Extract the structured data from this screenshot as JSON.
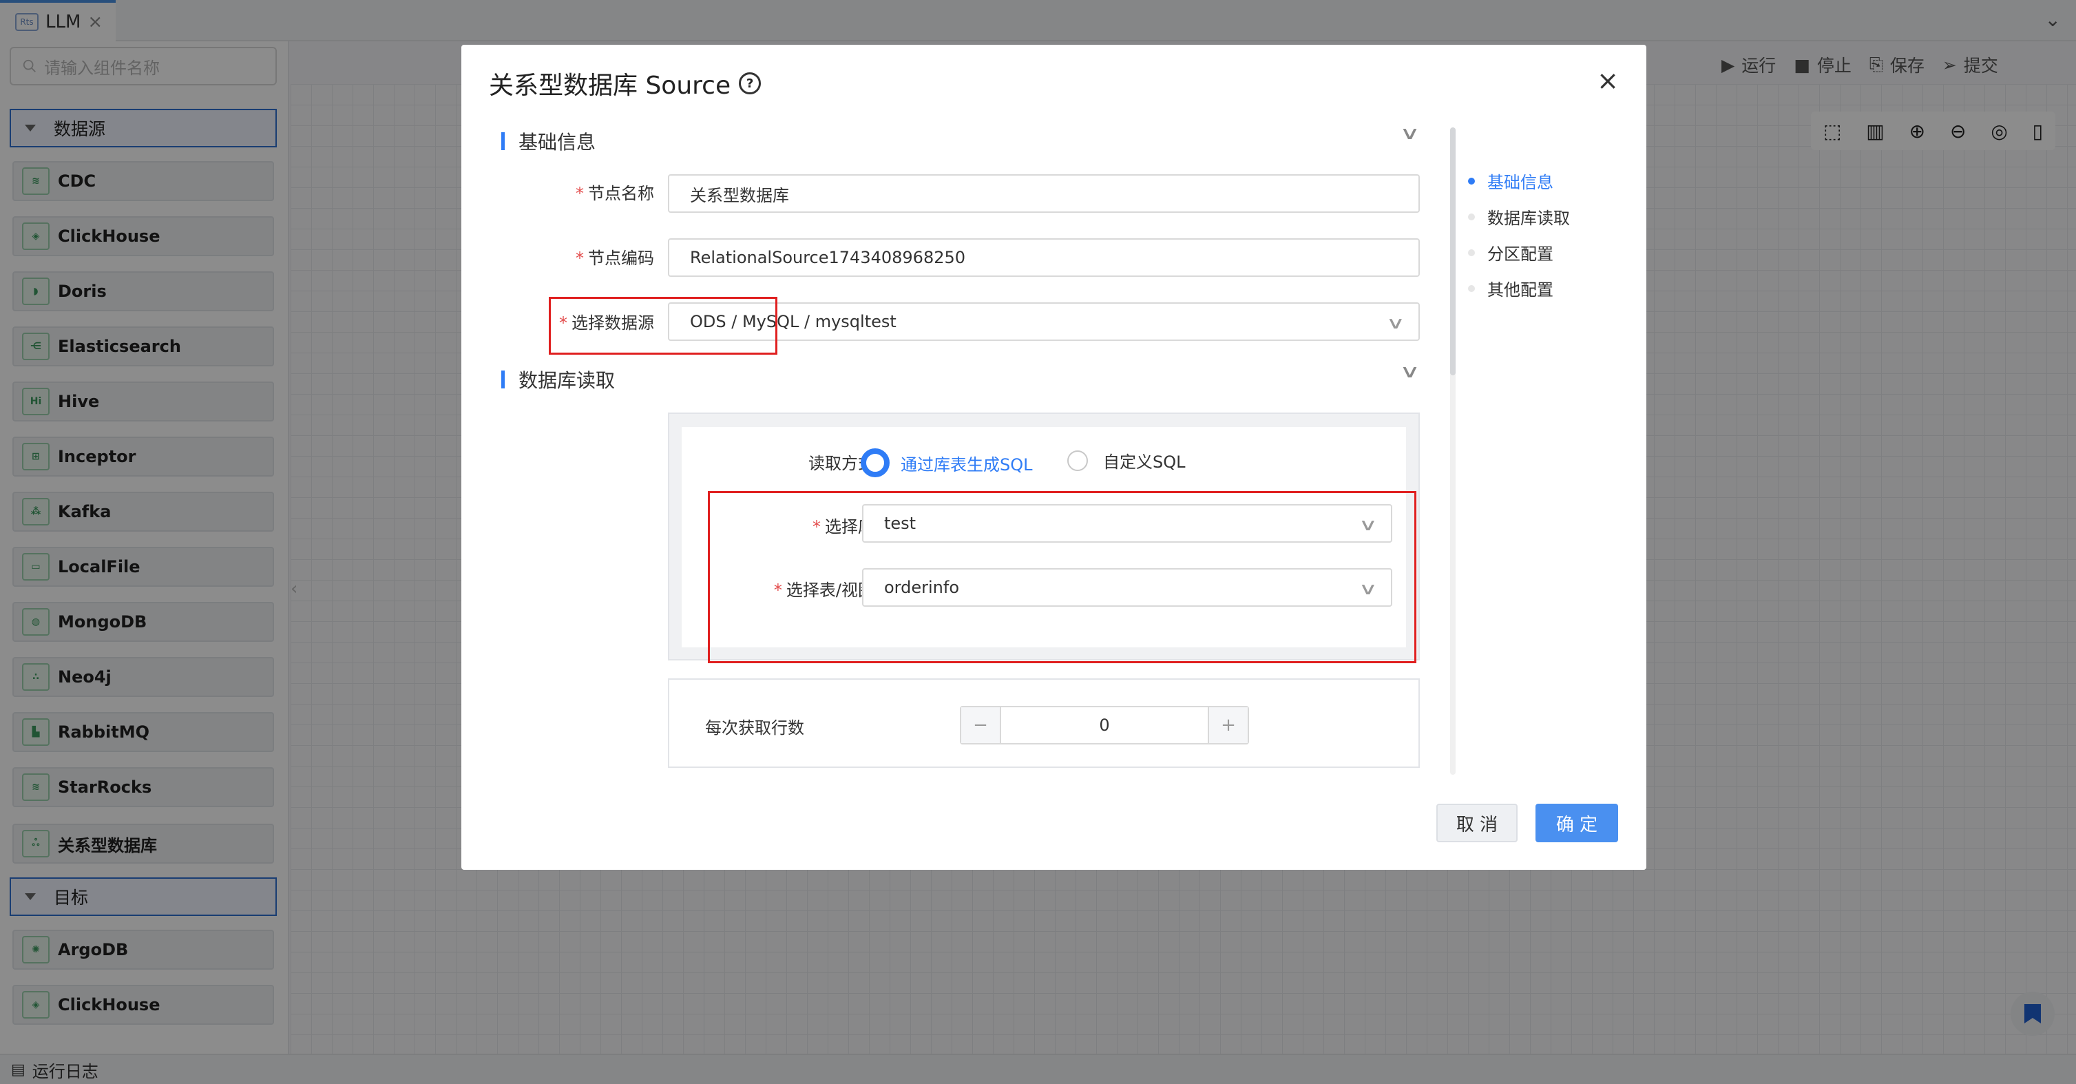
{
  "tab": {
    "icon_text": "Rts",
    "label": "LLM"
  },
  "sidebar": {
    "search_placeholder": "请输入组件名称",
    "group_source": "数据源",
    "sources": [
      "CDC",
      "ClickHouse",
      "Doris",
      "Elasticsearch",
      "Hive",
      "Inceptor",
      "Kafka",
      "LocalFile",
      "MongoDB",
      "Neo4j",
      "RabbitMQ",
      "StarRocks",
      "关系型数据库"
    ],
    "group_target": "目标",
    "targets": [
      "ArgoDB",
      "ClickHouse"
    ]
  },
  "toolbar": {
    "run": "运行",
    "stop": "停止",
    "save": "保存",
    "submit": "提交"
  },
  "log_bar": {
    "label": "运行日志"
  },
  "modal": {
    "title": "关系型数据库 Source",
    "section_basic": "基础信息",
    "node_name_label": "节点名称",
    "node_name_value": "关系型数据库",
    "node_code_label": "节点编码",
    "node_code_value": "RelationalSource1743408968250",
    "datasource_label": "选择数据源",
    "datasource_value": "ODS / MySQL / mysqltest",
    "section_db_read": "数据库读取",
    "read_mode_label": "读取方式",
    "read_mode_option1": "通过库表生成SQL",
    "read_mode_option2": "自定义SQL",
    "select_db_label": "选择库",
    "select_db_value": "test",
    "select_table_label": "选择表/视图",
    "select_table_value": "orderinfo",
    "fetch_rows_label": "每次获取行数",
    "fetch_rows_value": "0",
    "anchors": [
      "基础信息",
      "数据库读取",
      "分区配置",
      "其他配置"
    ],
    "cancel": "取 消",
    "confirm": "确 定"
  }
}
